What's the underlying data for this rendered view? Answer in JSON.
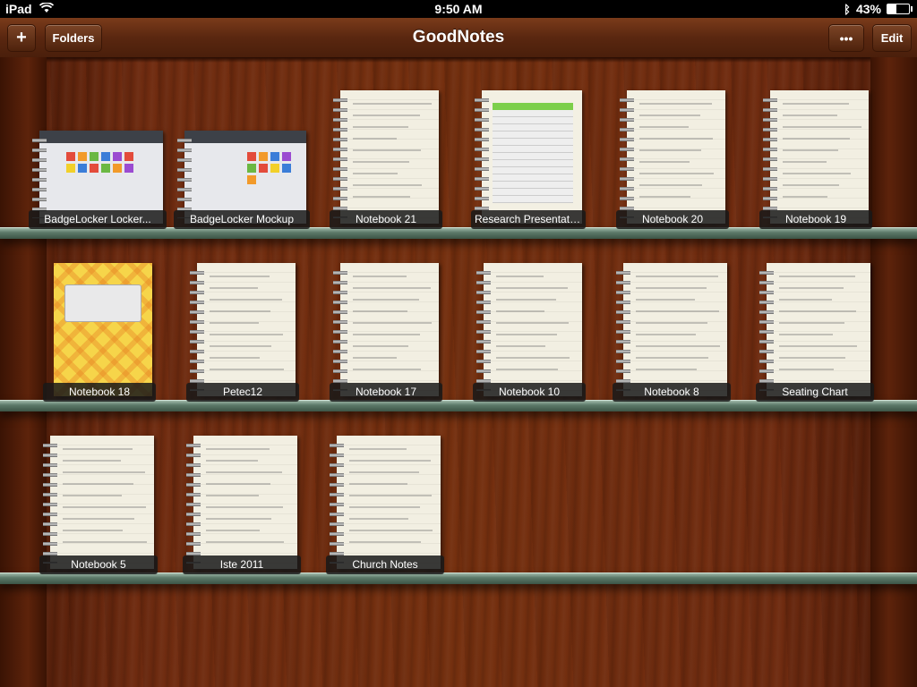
{
  "status_bar": {
    "device": "iPad",
    "time": "9:50 AM",
    "battery": "43%",
    "battery_level": 0.43
  },
  "toolbar": {
    "title": "GoodNotes",
    "add_label": "+",
    "folders_label": "Folders",
    "more_label": "•••",
    "edit_label": "Edit"
  },
  "shelves": [
    {
      "notebooks": [
        {
          "title": "BadgeLocker Locker...",
          "style": "screenshot"
        },
        {
          "title": "BadgeLocker Mockup",
          "style": "screenshot"
        },
        {
          "title": "Notebook 21",
          "style": "lined"
        },
        {
          "title": "Research Presentatio...",
          "style": "table"
        },
        {
          "title": "Notebook 20",
          "style": "lined"
        },
        {
          "title": "Notebook 19",
          "style": "lined"
        }
      ]
    },
    {
      "notebooks": [
        {
          "title": "Notebook 18",
          "style": "yellow"
        },
        {
          "title": "Petec12",
          "style": "lined"
        },
        {
          "title": "Notebook 17",
          "style": "lined"
        },
        {
          "title": "Notebook 10",
          "style": "lined"
        },
        {
          "title": "Notebook 8",
          "style": "lined"
        },
        {
          "title": "Seating Chart",
          "style": "lined"
        }
      ]
    },
    {
      "notebooks": [
        {
          "title": "Notebook 5",
          "style": "lined"
        },
        {
          "title": "Iste 2011",
          "style": "lined"
        },
        {
          "title": "Church Notes",
          "style": "lined"
        }
      ]
    }
  ]
}
